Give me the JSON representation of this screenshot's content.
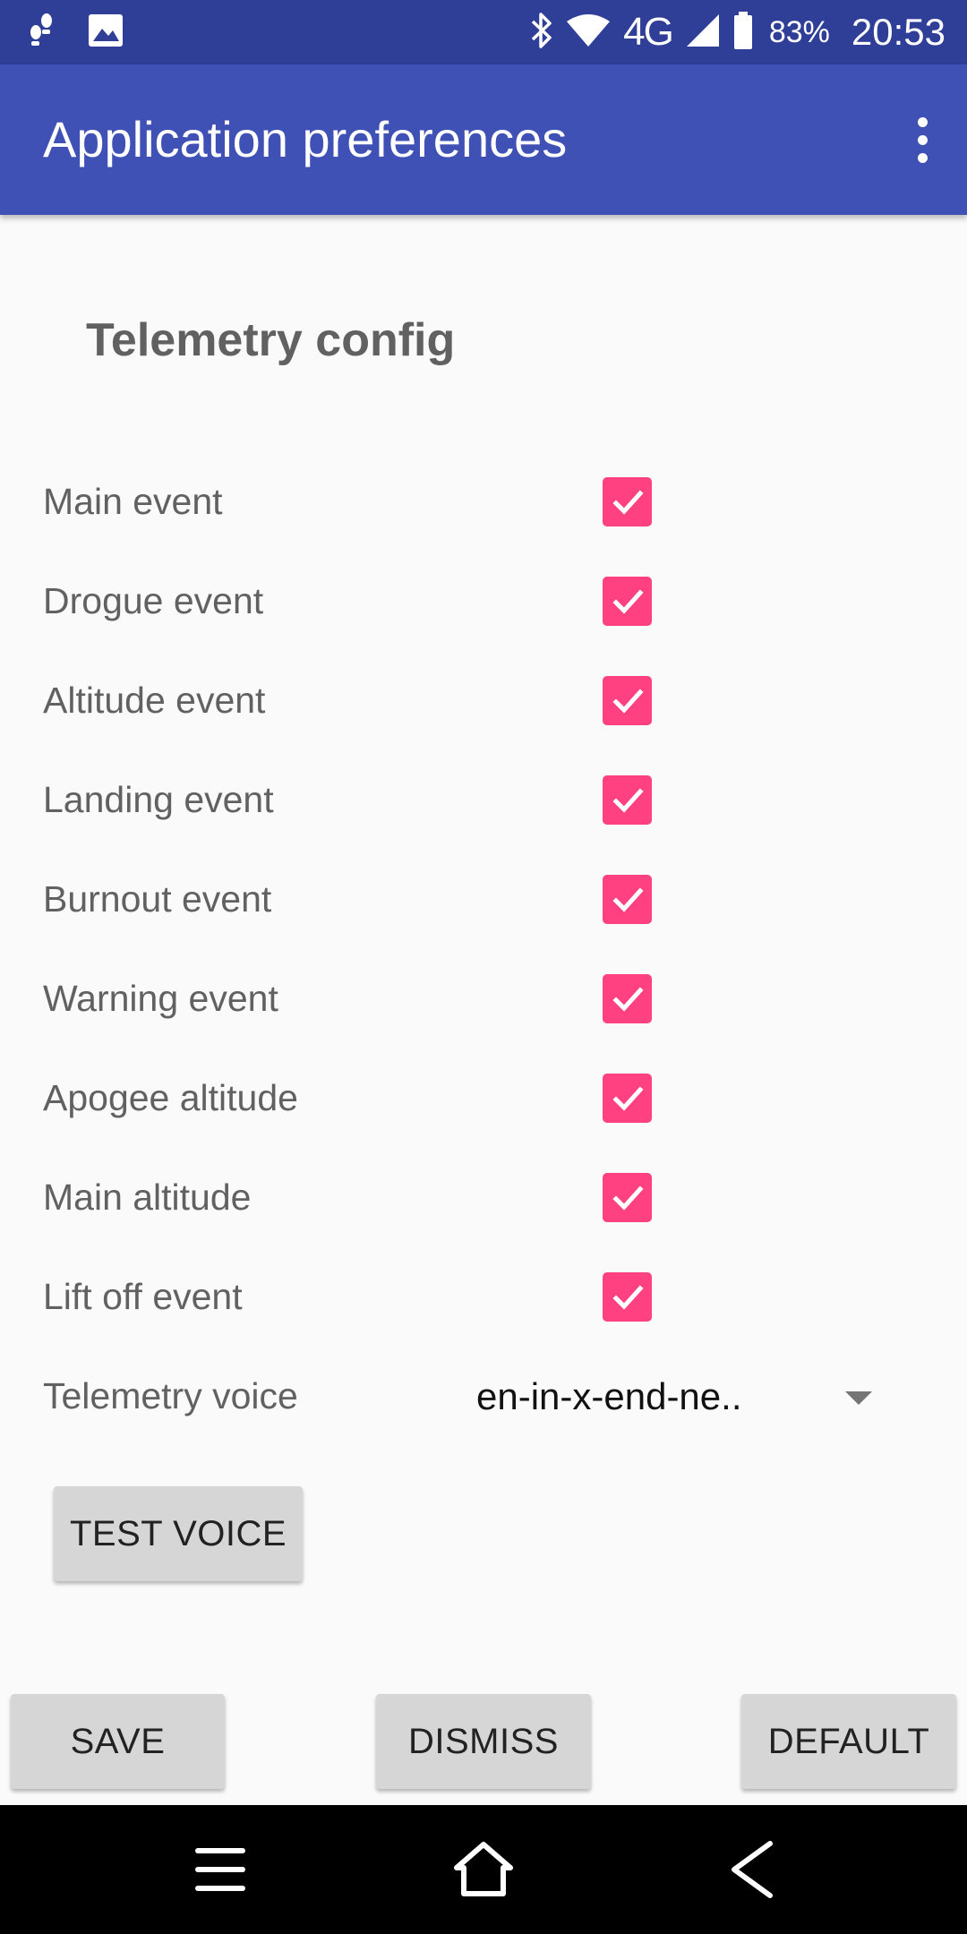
{
  "status_bar": {
    "network": "4G",
    "battery": "83%",
    "time": "20:53"
  },
  "app_bar": {
    "title": "Application preferences",
    "menu_icon": "more-vert-icon"
  },
  "section": {
    "title": "Telemetry config"
  },
  "preferences": [
    {
      "label": "Main event",
      "checked": true
    },
    {
      "label": "Drogue event",
      "checked": true
    },
    {
      "label": "Altitude event",
      "checked": true
    },
    {
      "label": "Landing event",
      "checked": true
    },
    {
      "label": "Burnout event",
      "checked": true
    },
    {
      "label": "Warning event",
      "checked": true
    },
    {
      "label": "Apogee altitude",
      "checked": true
    },
    {
      "label": "Main altitude",
      "checked": true
    },
    {
      "label": "Lift off event",
      "checked": true
    }
  ],
  "voice": {
    "label": "Telemetry voice",
    "selected": "en-in-x-end-ne.."
  },
  "buttons": {
    "test_voice": "TEST VOICE",
    "save": "SAVE",
    "dismiss": "DISMISS",
    "default": "DEFAULT"
  },
  "colors": {
    "status_bar": "#2f3e96",
    "app_bar": "#3f51b5",
    "checkbox": "#ff4081",
    "background": "#fafafa"
  },
  "nav_bar": {
    "icons": [
      "menu-icon",
      "home-icon",
      "back-icon"
    ]
  }
}
